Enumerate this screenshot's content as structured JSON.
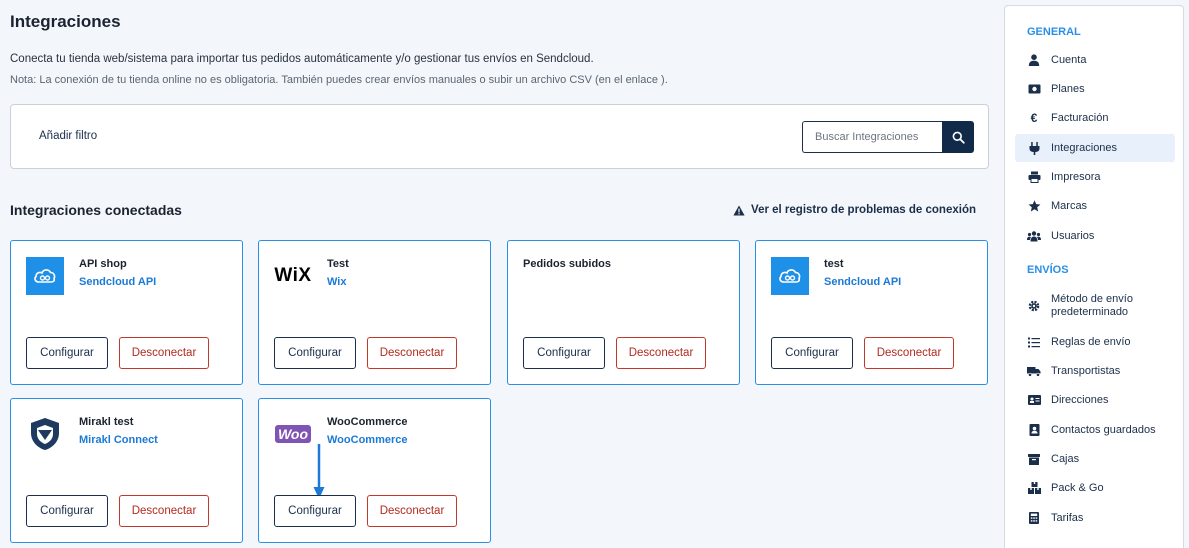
{
  "page": {
    "title": "Integraciones",
    "description": "Conecta tu tienda web/sistema para importar tus pedidos automáticamente y/o gestionar tus envíos en Sendcloud.",
    "note": "Nota: La conexión de tu tienda online no es obligatoria. También puedes crear envíos manuales o subir un archivo CSV (en el enlace )."
  },
  "filter": {
    "add_filter_label": "Añadir filtro",
    "search_placeholder": "Buscar Integraciones"
  },
  "connected": {
    "title": "Integraciones conectadas",
    "log_link": "Ver el registro de problemas de conexión",
    "cards": [
      {
        "name": "API shop",
        "type": "Sendcloud API",
        "logo": "sendcloud-cloud-icon",
        "configure": "Configurar",
        "disconnect": "Desconectar"
      },
      {
        "name": "Test",
        "type": "Wix",
        "logo": "wix-logo",
        "logo_text": "WiX",
        "configure": "Configurar",
        "disconnect": "Desconectar"
      },
      {
        "name": "Pedidos subidos",
        "type": "",
        "logo": "",
        "configure": "Configurar",
        "disconnect": "Desconectar"
      },
      {
        "name": "test",
        "type": "Sendcloud API",
        "logo": "sendcloud-cloud-icon",
        "configure": "Configurar",
        "disconnect": "Desconectar"
      },
      {
        "name": "Mirakl test",
        "type": "Mirakl Connect",
        "logo": "mirakl-shield-icon",
        "configure": "Configurar",
        "disconnect": "Desconectar"
      },
      {
        "name": "WooCommerce",
        "type": "WooCommerce",
        "logo": "woocommerce-logo",
        "logo_text": "Woo",
        "configure": "Configurar",
        "disconnect": "Desconectar"
      }
    ]
  },
  "sidebar": {
    "general_label": "GENERAL",
    "shipping_label": "ENVÍOS",
    "general_items": [
      {
        "label": "Cuenta",
        "icon": "user-icon"
      },
      {
        "label": "Planes",
        "icon": "money-icon"
      },
      {
        "label": "Facturación",
        "icon": "euro-icon"
      },
      {
        "label": "Integraciones",
        "icon": "plug-icon",
        "active": true
      },
      {
        "label": "Impresora",
        "icon": "printer-icon"
      },
      {
        "label": "Marcas",
        "icon": "star-icon"
      },
      {
        "label": "Usuarios",
        "icon": "users-icon"
      }
    ],
    "shipping_items": [
      {
        "label": "Método de envío\npredeterminado",
        "icon": "gear-icon"
      },
      {
        "label": "Reglas de envío",
        "icon": "rules-icon"
      },
      {
        "label": "Transportistas",
        "icon": "truck-icon"
      },
      {
        "label": "Direcciones",
        "icon": "address-card-icon"
      },
      {
        "label": "Contactos guardados",
        "icon": "contact-book-icon"
      },
      {
        "label": "Cajas",
        "icon": "box-icon"
      },
      {
        "label": "Pack & Go",
        "icon": "boxes-icon"
      },
      {
        "label": "Tarifas",
        "icon": "calculator-icon"
      }
    ]
  },
  "colors": {
    "accent": "#2a8fe6",
    "navy": "#112a4a",
    "danger": "#b22a1f",
    "mirakl": "#1e3a5f",
    "woo": "#7f54b3"
  }
}
